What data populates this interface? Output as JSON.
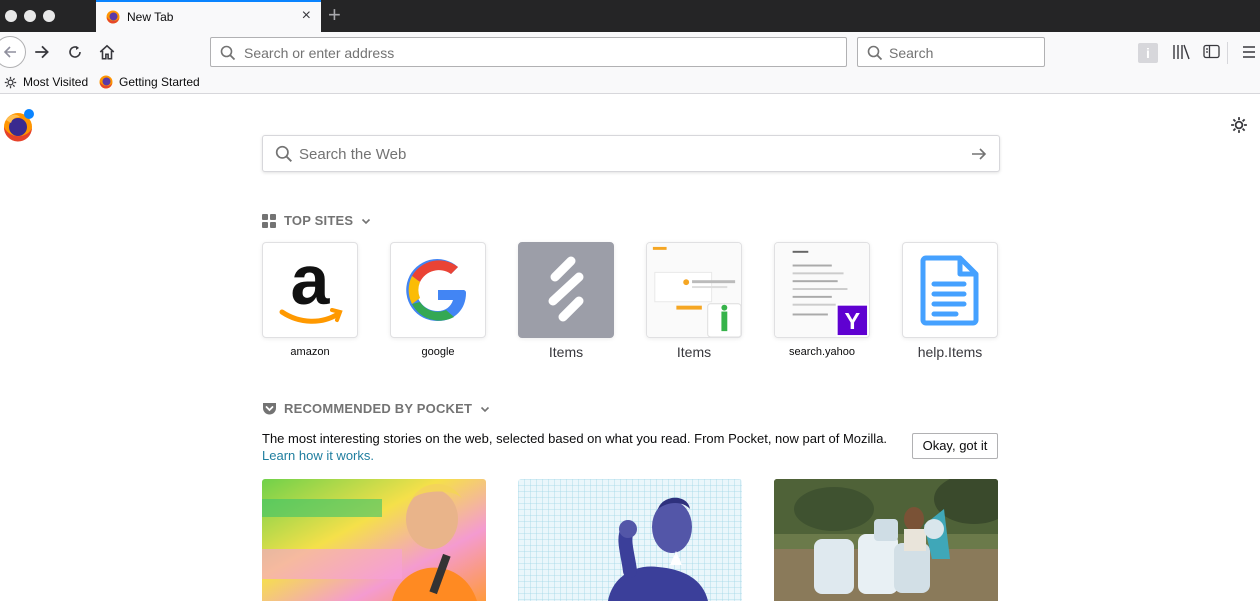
{
  "tab": {
    "title": "New Tab",
    "close": "×",
    "new_tab": "+"
  },
  "nav": {
    "url_placeholder": "Search or enter address",
    "search_placeholder": "Search",
    "ext_badge": "i"
  },
  "bookmarks": [
    {
      "label": "Most Visited",
      "icon": "gear-icon"
    },
    {
      "label": "Getting Started",
      "icon": "firefox-icon"
    }
  ],
  "websearch": {
    "placeholder": "Search the Web"
  },
  "top_sites": {
    "heading": "TOP SITES",
    "sites": [
      {
        "label": "amazon"
      },
      {
        "label": "google"
      },
      {
        "label": "Items"
      },
      {
        "label": "Items"
      },
      {
        "label": "search.yahoo"
      },
      {
        "label": "help.Items"
      }
    ]
  },
  "pocket": {
    "heading": "RECOMMENDED BY POCKET",
    "description": "The most interesting stories on the web, selected based on what you read. From Pocket, now part of Mozilla.",
    "learn_link": "Learn how it works.",
    "okay_button": "Okay, got it"
  },
  "colors": {
    "accent": "#0a84ff",
    "tabstrip": "#252526",
    "toolbar": "#f9f9fa"
  }
}
